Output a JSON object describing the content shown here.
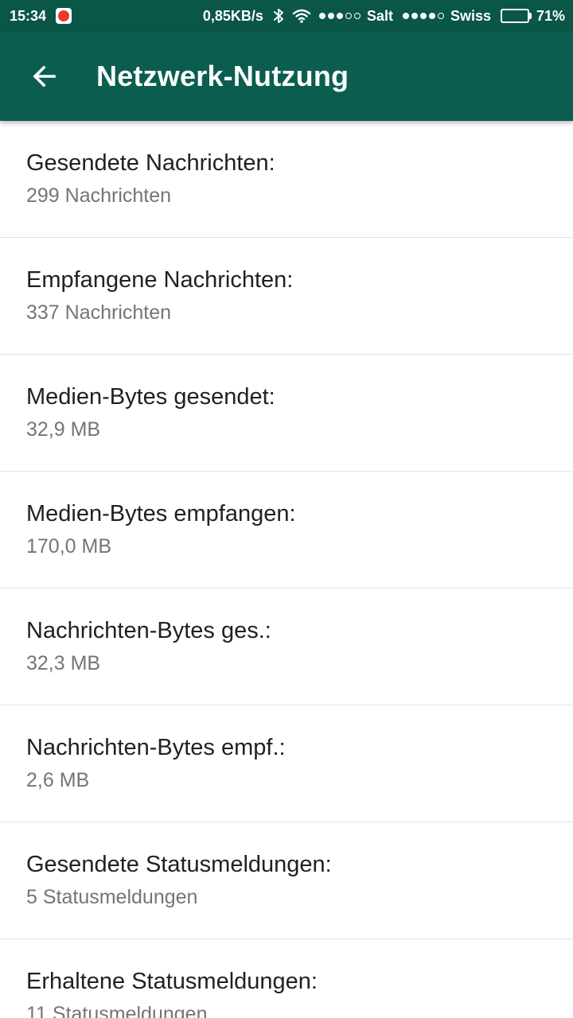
{
  "status_bar": {
    "time": "15:34",
    "net_speed": "0,85KB/s",
    "carrier_1": "Salt",
    "carrier_2": "Swiss",
    "battery_percent": "71%",
    "battery_level": 0.71,
    "signal_1_bars": 3,
    "signal_2_bars": 4,
    "bar_color": "#0a5647",
    "app_icon": "notification-app-icon"
  },
  "app_bar": {
    "title": "Netzwerk-Nutzung",
    "back_icon": "arrow-left-icon",
    "color": "#0b5e4f"
  },
  "items": [
    {
      "label": "Gesendete Nachrichten:",
      "value": "299 Nachrichten"
    },
    {
      "label": "Empfangene Nachrichten:",
      "value": "337 Nachrichten"
    },
    {
      "label": "Medien-Bytes gesendet:",
      "value": "32,9 MB"
    },
    {
      "label": "Medien-Bytes empfangen:",
      "value": "170,0 MB"
    },
    {
      "label": "Nachrichten-Bytes ges.:",
      "value": "32,3 MB"
    },
    {
      "label": "Nachrichten-Bytes empf.:",
      "value": "2,6 MB"
    },
    {
      "label": "Gesendete Statusmeldungen:",
      "value": "5 Statusmeldungen"
    },
    {
      "label": "Erhaltene Statusmeldungen:",
      "value": "11 Statusmeldungen"
    }
  ]
}
